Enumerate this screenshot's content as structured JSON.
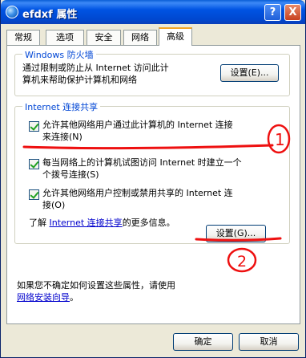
{
  "window": {
    "title": "efdxf 属性",
    "help_label": "?",
    "close_label": "X"
  },
  "tabs": [
    {
      "label": "常规"
    },
    {
      "label": "选项"
    },
    {
      "label": "安全"
    },
    {
      "label": "网络"
    },
    {
      "label": "高级"
    }
  ],
  "firewall": {
    "title": "Windows 防火墙",
    "description_line1": "通过限制或防止从 Internet 访问此计",
    "description_line2": "算机来帮助保护计算机和网络",
    "settings_button": "设置(E)..."
  },
  "ics": {
    "title": "Internet 连接共享",
    "option1_line1": "允许其他网络用户通过此计算机的 Internet 连接",
    "option1_line2": "来连接(N)",
    "option2_line1": "每当网络上的计算机试图访问 Internet 时建立一个",
    "option2_line2": "个拨号连接(S)",
    "option3_line1": "允许其他网络用户控制或禁用共享的 Internet 连",
    "option3_line2": "接(O)",
    "learn_prefix": "了解 ",
    "learn_link": "Internet 连接共享",
    "learn_suffix": "的更多信息。",
    "settings_button": "设置(G)..."
  },
  "footer": {
    "text": "如果您不确定如何设置这些属性，请使用",
    "wizard_link": "网络安装向导",
    "period": "。"
  },
  "buttons": {
    "ok": "确定",
    "cancel": "取消"
  },
  "annotations": {
    "mark1": "1",
    "mark2": "2"
  }
}
